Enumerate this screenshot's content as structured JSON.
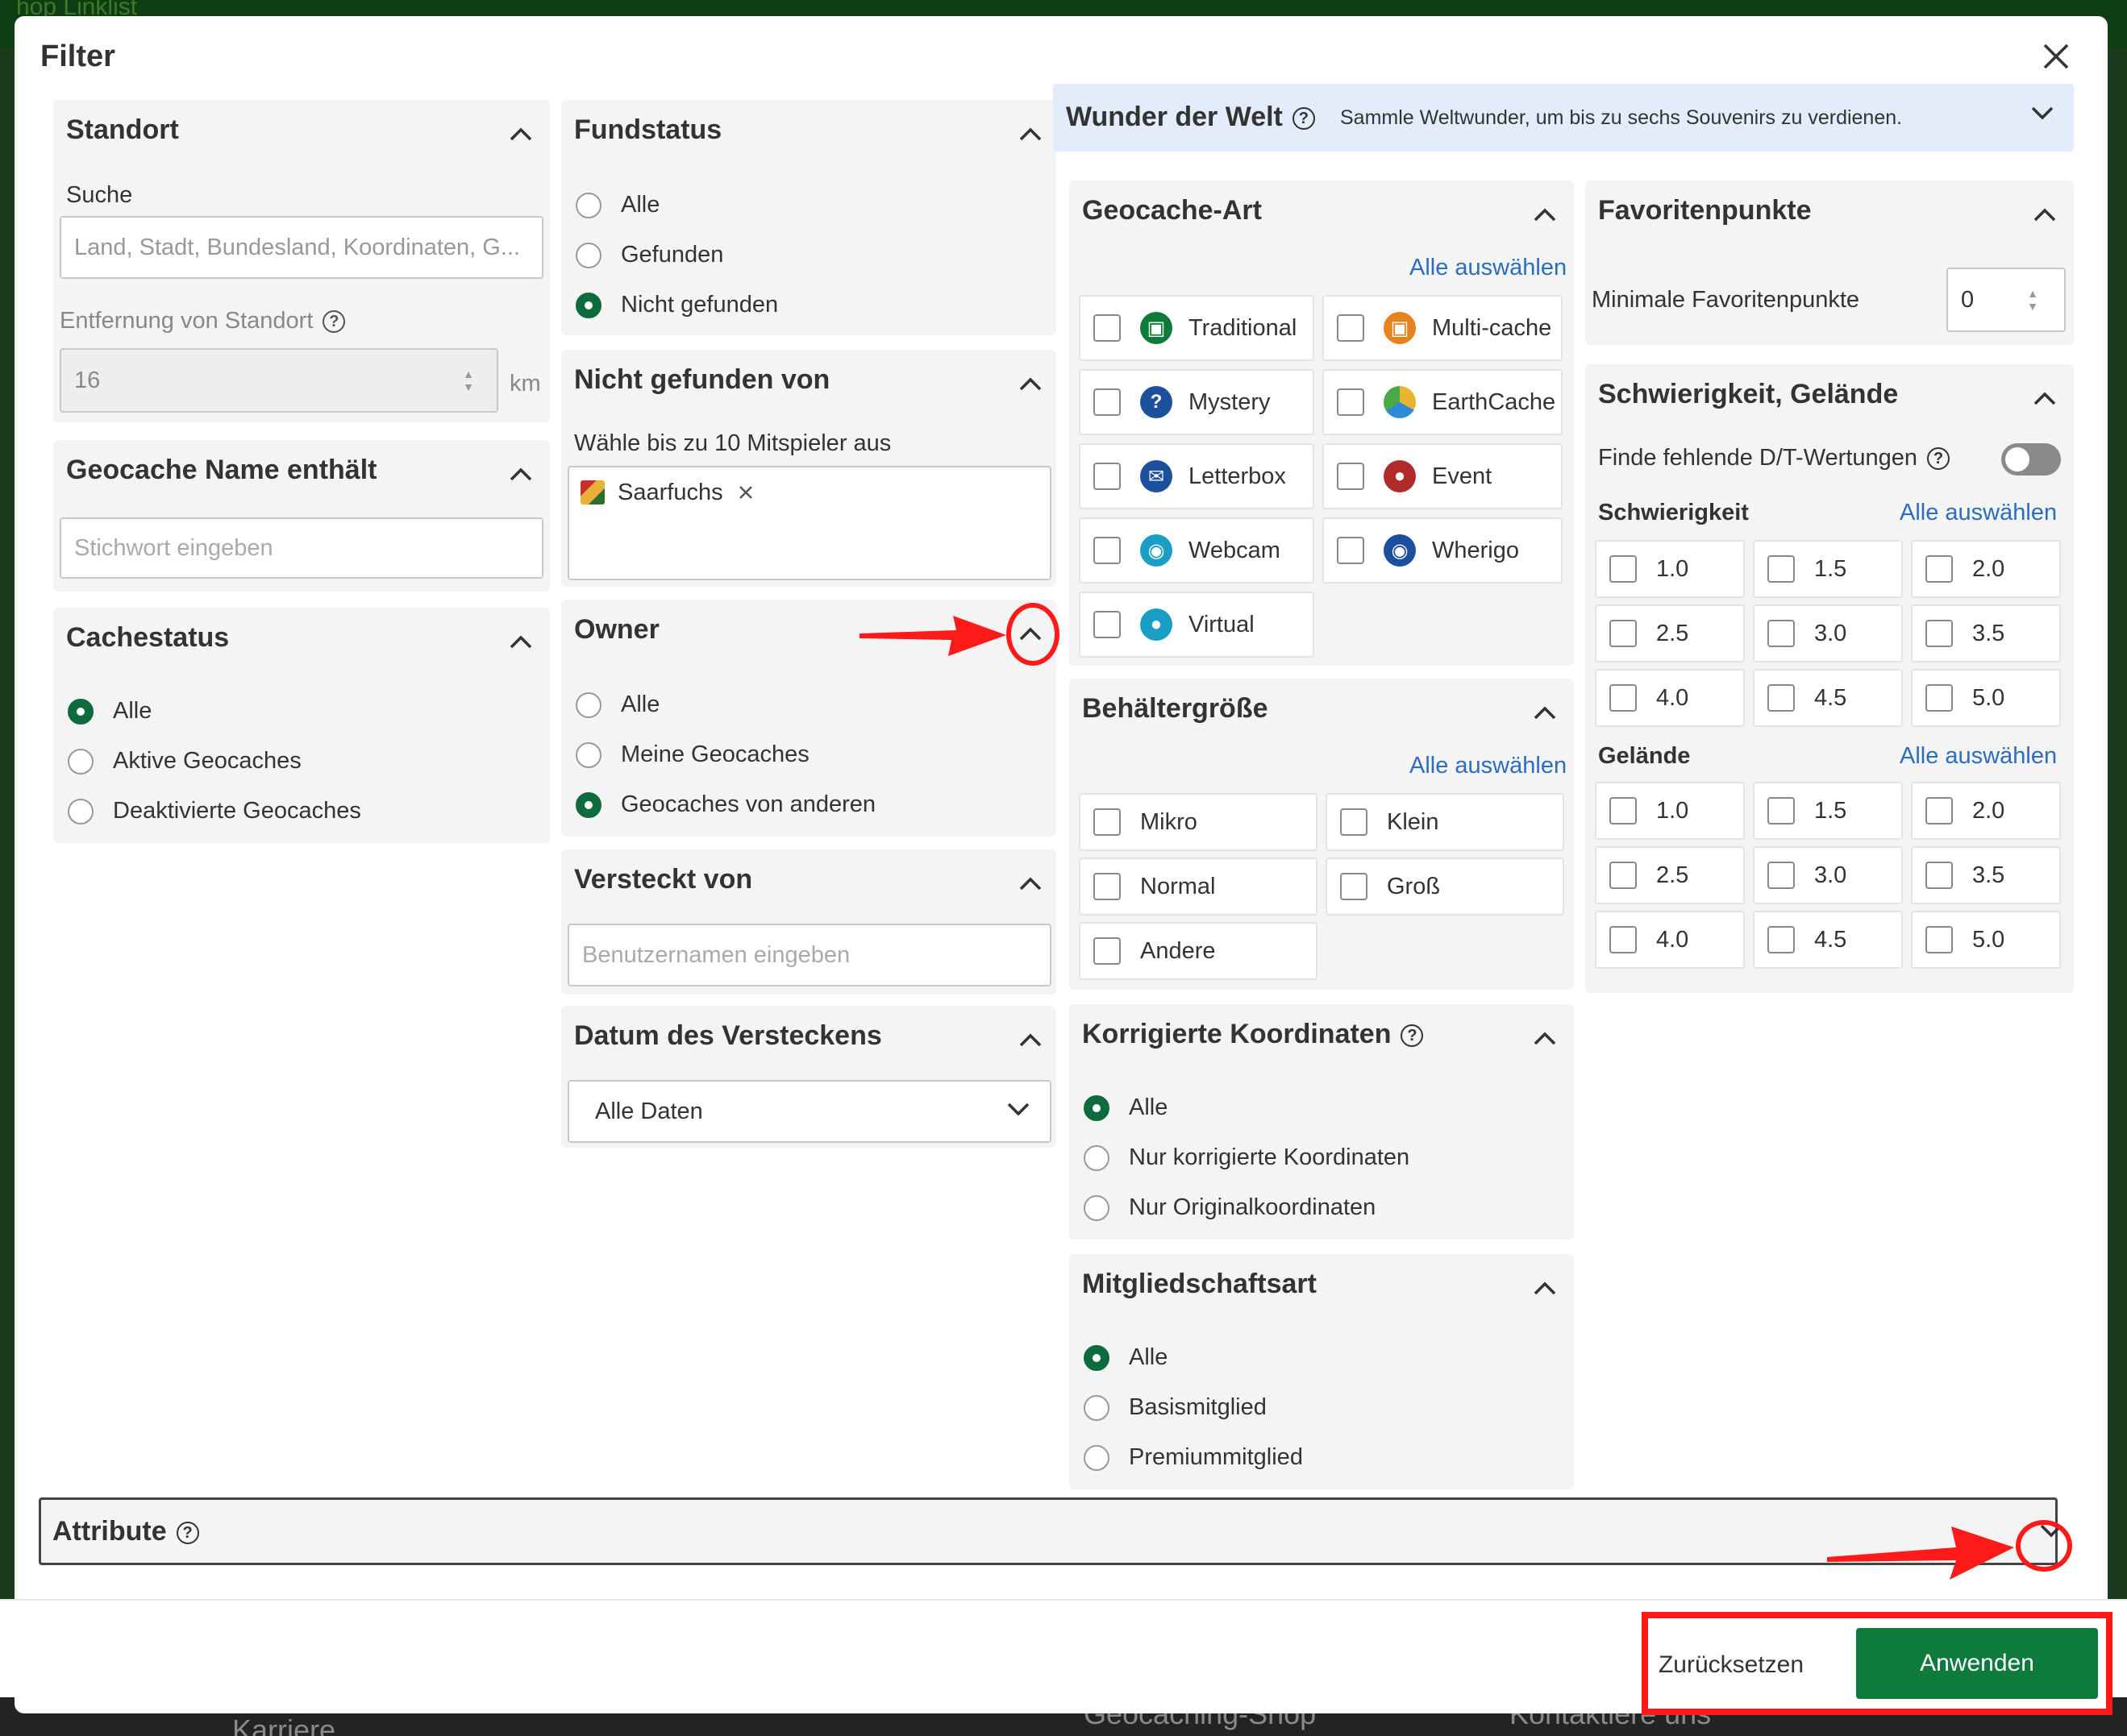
{
  "modal": {
    "title": "Filter"
  },
  "standort": {
    "title": "Standort",
    "search_label": "Suche",
    "search_placeholder": "Land, Stadt, Bundesland, Koordinaten, G...",
    "distance_label": "Entfernung von Standort",
    "distance_value": "16",
    "distance_unit": "km"
  },
  "name": {
    "title": "Geocache Name enthält",
    "placeholder": "Stichwort eingeben"
  },
  "cachestatus": {
    "title": "Cachestatus",
    "options": [
      "Alle",
      "Aktive Geocaches",
      "Deaktivierte Geocaches"
    ],
    "selected": 0
  },
  "fundstatus": {
    "title": "Fundstatus",
    "options": [
      "Alle",
      "Gefunden",
      "Nicht gefunden"
    ],
    "selected": 2
  },
  "not_found_by": {
    "title": "Nicht gefunden von",
    "hint": "Wähle bis zu 10 Mitspieler aus",
    "chip": "Saarfuchs"
  },
  "owner": {
    "title": "Owner",
    "options": [
      "Alle",
      "Meine Geocaches",
      "Geocaches von anderen"
    ],
    "selected": 2
  },
  "hidden_by": {
    "title": "Versteckt von",
    "placeholder": "Benutzernamen eingeben"
  },
  "hidden_date": {
    "title": "Datum des Versteckens",
    "value": "Alle Daten"
  },
  "wonder": {
    "title": "Wunder der Welt",
    "desc": "Sammle Weltwunder, um bis zu sechs Souvenirs zu verdienen."
  },
  "cachetype": {
    "title": "Geocache-Art",
    "select_all": "Alle auswählen",
    "items": [
      "Traditional",
      "Multi-cache",
      "Mystery",
      "EarthCache",
      "Letterbox",
      "Event",
      "Webcam",
      "Wherigo",
      "Virtual"
    ]
  },
  "size": {
    "title": "Behältergröße",
    "select_all": "Alle auswählen",
    "items": [
      "Mikro",
      "Klein",
      "Normal",
      "Groß",
      "Andere"
    ]
  },
  "corrected": {
    "title": "Korrigierte Koordinaten",
    "options": [
      "Alle",
      "Nur korrigierte Koordinaten",
      "Nur Originalkoordinaten"
    ],
    "selected": 0
  },
  "membership": {
    "title": "Mitgliedschaftsart",
    "options": [
      "Alle",
      "Basismitglied",
      "Premiummitglied"
    ],
    "selected": 0
  },
  "favorites": {
    "title": "Favoritenpunkte",
    "label": "Minimale Favoritenpunkte",
    "value": "0"
  },
  "dt": {
    "title": "Schwierigkeit, Gelände",
    "missing_label": "Finde fehlende D/T-Wertungen",
    "difficulty_label": "Schwierigkeit",
    "terrain_label": "Gelände",
    "select_all": "Alle auswählen",
    "values": [
      "1.0",
      "1.5",
      "2.0",
      "2.5",
      "3.0",
      "3.5",
      "4.0",
      "4.5",
      "5.0"
    ]
  },
  "attribute": {
    "title": "Attribute"
  },
  "footer": {
    "reset": "Zurücksetzen",
    "apply": "Anwenden"
  },
  "background": {
    "links": [
      "Karriere",
      "Geocaching-Shop",
      "Kontaktiere uns"
    ],
    "top_text": "hop   Linklist"
  },
  "colors": {
    "accent": "#0e7a3c",
    "link": "#2b6dbf",
    "annotation": "#ff1a1a",
    "wonder_bg": "#e3ecfa"
  }
}
